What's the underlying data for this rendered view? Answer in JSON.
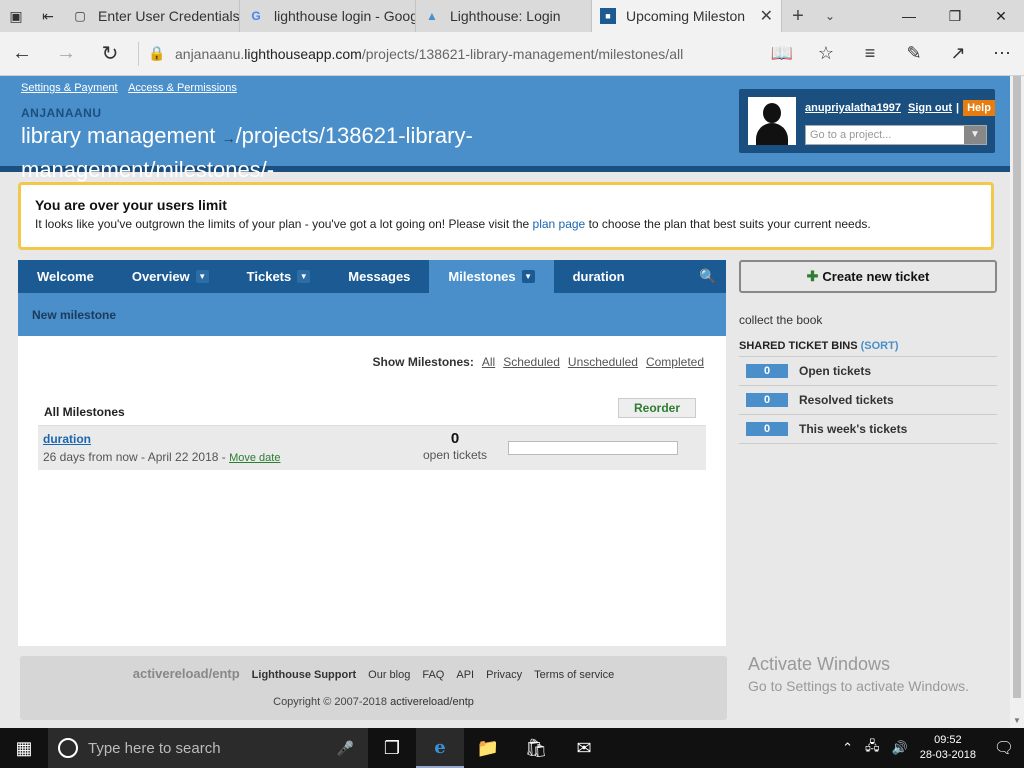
{
  "browser": {
    "tabs": [
      {
        "label": "Enter User Credentials",
        "icon": "window-icon"
      },
      {
        "label": "lighthouse login - Goog",
        "icon": "google-icon"
      },
      {
        "label": "Lighthouse: Login",
        "icon": "lighthouse-icon"
      },
      {
        "label": "Upcoming Mileston",
        "icon": "lighthouse-icon"
      }
    ],
    "url_domain_prefix": "anjanaanu.",
    "url_domain": "lighthouseapp.com",
    "url_path": "/projects/138621-library-management/milestones/all"
  },
  "header": {
    "links": [
      "Settings & Payment",
      "Access & Permissions"
    ],
    "account": "ANJANAANU",
    "project_title": "library management",
    "project_path": "/projects/138621-library-management/milestones/-",
    "username": "anupriyalatha1997",
    "signout": "Sign out",
    "help": "Help",
    "project_select_placeholder": "Go to a project..."
  },
  "alert": {
    "title": "You are over your users limit",
    "text_before": "It looks like you've outgrown the limits of your plan - you've got a lot going on! Please visit the ",
    "link": "plan page",
    "text_after": " to choose the plan that best suits your current needs."
  },
  "nav": {
    "tabs": [
      "Welcome",
      "Overview",
      "Tickets",
      "Messages",
      "Milestones",
      "duration"
    ],
    "sub_link": "New milestone"
  },
  "milestones": {
    "show_label": "Show Milestones:",
    "filters": [
      "All",
      "Scheduled",
      "Unscheduled",
      "Completed"
    ],
    "heading": "All Milestones",
    "reorder": "Reorder",
    "row": {
      "name": "duration",
      "due": "26 days from now - April 22 2018 - ",
      "move": "Move date",
      "count": "0",
      "count_label": "open tickets",
      "progress_fraction": 0
    }
  },
  "sidebar": {
    "new_ticket": "Create new ticket",
    "description": "collect the book",
    "bins_title": "SHARED TICKET BINS",
    "sort": "(SORT)",
    "bins": [
      {
        "count": "0",
        "label": "Open tickets"
      },
      {
        "count": "0",
        "label": "Resolved tickets"
      },
      {
        "count": "0",
        "label": "This week's tickets"
      }
    ]
  },
  "footer": {
    "brand": "activereload/entp",
    "links": [
      "Lighthouse Support",
      "Our blog",
      "FAQ",
      "API",
      "Privacy",
      "Terms of service"
    ],
    "copyright_prefix": "Copyright © 2007-2018 ",
    "copyright_link": "activereload/entp"
  },
  "watermark": {
    "title": "Activate Windows",
    "sub": "Go to Settings to activate Windows."
  },
  "taskbar": {
    "search_placeholder": "Type here to search",
    "time": "09:52",
    "date": "28-03-2018"
  }
}
